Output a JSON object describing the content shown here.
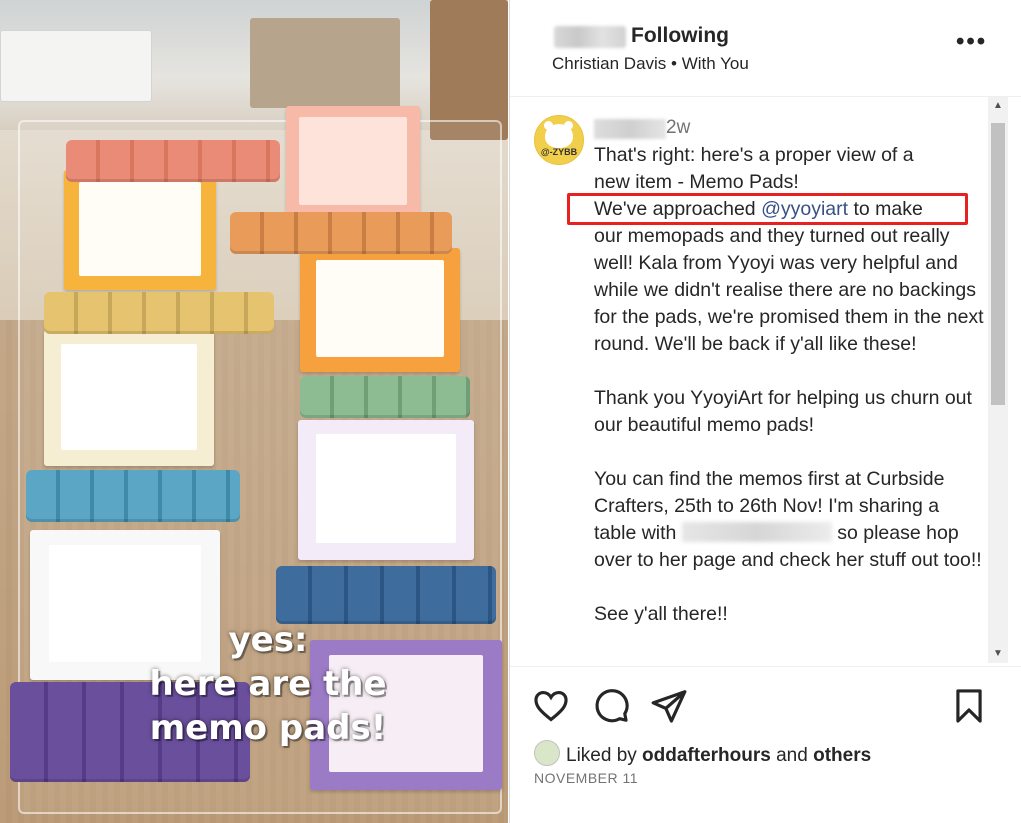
{
  "post": {
    "header": {
      "following_label": "Following",
      "subtitle": "Christian Davis • With You",
      "more_icon": "more-options-icon",
      "more_label": "•••"
    },
    "media": {
      "overlay_text_lines": [
        "yes:",
        "here are the",
        "memo pads!"
      ]
    },
    "comment": {
      "avatar_text": "@-ZYBB",
      "time_ago": "2w",
      "caption_line1": "That's right: here's a proper view of a",
      "caption_line2": "new item - Memo Pads!",
      "caption_line3_before": "We've approached ",
      "caption_line3_mention": "@yyoyiart",
      "caption_line3_after": " to make",
      "caption_para1_rest": "our memopads and they turned out really well! Kala from Yyoyi was very helpful and while we didn't realise there are no backings for the pads, we're promised them in the next round. We'll be back if y'all like these!",
      "caption_para2": "Thank you YyoyiArt for helping us churn out our beautiful memo pads!",
      "caption_para3_before": "You can find the memos first at Curbside Crafters, 25th to 26th Nov! I'm sharing a table with ",
      "caption_para3_after": " so please hop over to her page and check her stuff out too!!",
      "caption_para4": "See y'all there!!"
    },
    "scrollbar": {
      "up_arrow": "▲",
      "down_arrow": "▼"
    },
    "actions": {
      "like_icon": "heart-icon",
      "comment_icon": "comment-icon",
      "share_icon": "share-icon",
      "save_icon": "bookmark-icon"
    },
    "likes": {
      "prefix": "Liked by ",
      "user": "oddafterhours",
      "middle": " and ",
      "others": "others"
    },
    "date": "NOVEMBER 11"
  }
}
